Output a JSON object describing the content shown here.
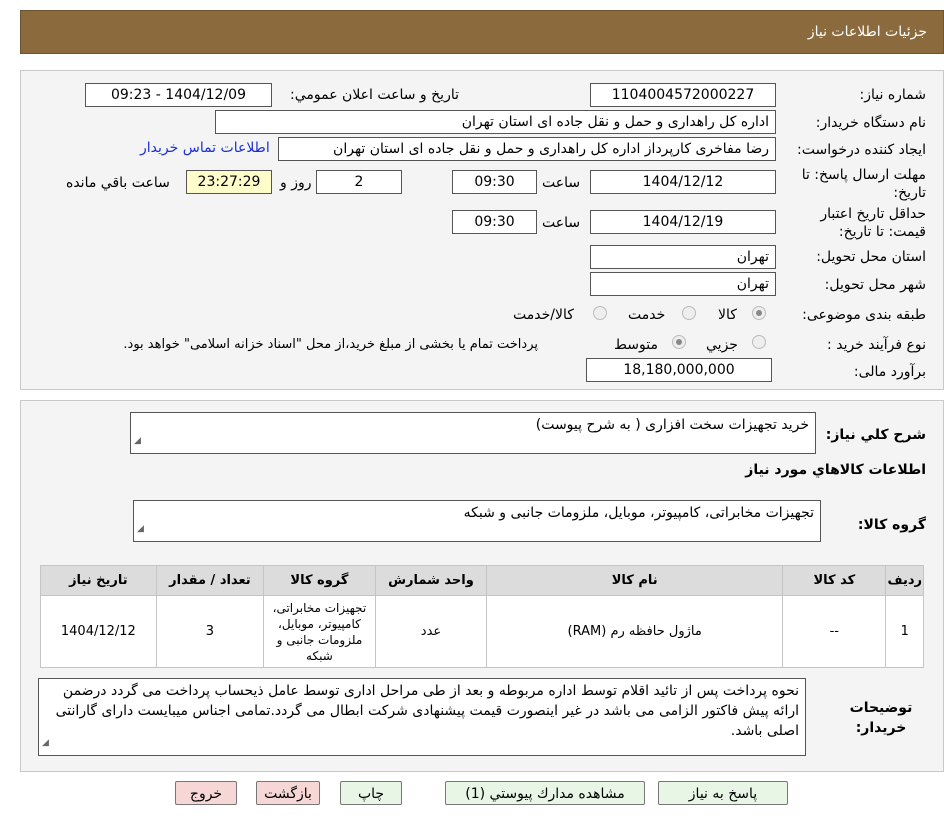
{
  "header": {
    "title": "جزئيات اطلاعات نياز"
  },
  "fields": {
    "need_number_label": "شماره نياز:",
    "need_number": "1104004572000227",
    "announce_label": "تاريخ و ساعت اعلان عمومي:",
    "announce_value": "1404/12/09 - 09:23",
    "buyer_org_label": "نام دستگاه خريدار:",
    "buyer_org": "اداره کل راهداری و حمل و نقل جاده ای استان تهران",
    "requester_label": "ايجاد کننده درخواست:",
    "requester": "رضا مفاخری کارپرداز اداره کل راهداری و حمل و نقل جاده ای استان تهران",
    "contact_link": "اطلاعات تماس خريدار",
    "reply_deadline_label": "مهلت ارسال پاسخ: تا تاریخ:",
    "reply_date": "1404/12/12",
    "time_label": "ساعت",
    "reply_time": "09:30",
    "days_value": "2",
    "days_label": "روز و",
    "remaining_time": "23:27:29",
    "remaining_label": "ساعت باقي مانده",
    "validity_label": "حداقل تاريخ اعتبار قيمت: تا تاریخ:",
    "validity_date": "1404/12/19",
    "validity_time": "09:30",
    "province_label": "استان محل تحويل:",
    "province": "تهران",
    "city_label": "شهر محل تحويل:",
    "city": "تهران",
    "category_label": "طبقه بندی موضوعی:",
    "category_options": [
      "کالا",
      "خدمت",
      "کالا/خدمت"
    ],
    "process_label": "نوع فرآيند خريد :",
    "process_options": [
      "جزيي",
      "متوسط"
    ],
    "process_note": "پرداخت تمام یا بخشی از مبلغ خرید،از محل \"اسناد خزانه اسلامی\" خواهد بود.",
    "estimate_label": "برآورد مالی:",
    "estimate": "18,180,000,000"
  },
  "summary": {
    "label": "شرح کلي نياز:",
    "value": "خرید تجهیزات سخت افزاری ( به شرح پیوست)"
  },
  "goods_section": {
    "title": "اطلاعات کالاهاي مورد نياز",
    "group_label": "گروه کالا:",
    "group_value": "تجهیزات مخابراتی، کامپیوتر، موبایل، ملزومات جانبی و شبکه"
  },
  "table": {
    "headers": [
      "رديف",
      "کد کالا",
      "نام کالا",
      "واحد شمارش",
      "گروه کالا",
      "تعداد / مقدار",
      "تاريخ نياز"
    ],
    "rows": [
      {
        "row": "1",
        "code": "--",
        "name": "ماژول حافظه رم (RAM)",
        "unit": "عدد",
        "group": "تجهیزات مخابراتی، کامپیوتر، موبایل، ملزومات جانبی و شبکه",
        "qty": "3",
        "date": "1404/12/12"
      }
    ]
  },
  "notes": {
    "label": "توضيحات خريدار:",
    "value": "نحوه پرداخت پس از تائید اقلام توسط اداره مربوطه و بعد از طی مراحل اداری توسط عامل ذیحساب پرداخت می گردد درضمن ارائه پیش فاکتور الزامی می باشد در غیر اینصورت قیمت پیشنهادی شرکت ابطال می گردد.تمامی اجناس میبایست دارای گارانتی اصلی باشد."
  },
  "buttons": {
    "reply": "پاسخ به نياز",
    "attachments": "مشاهده مدارك پيوستي (1)",
    "print": "چاپ",
    "back": "بازگشت",
    "exit": "خروج"
  },
  "colors": {
    "header_bg": "#8b6b3d",
    "link": "#1a2fd8",
    "timer_bg": "#fefcc8"
  }
}
